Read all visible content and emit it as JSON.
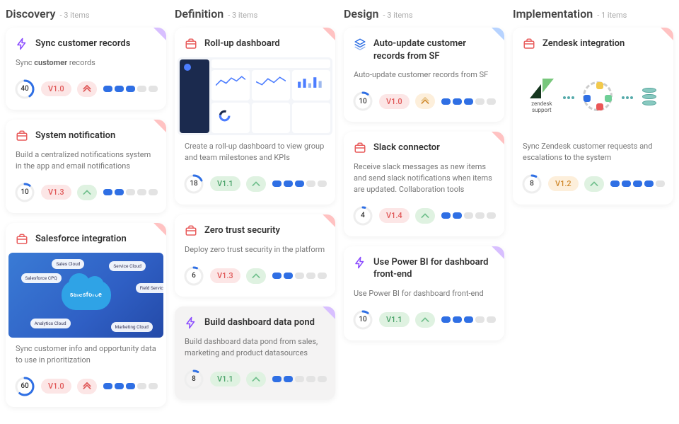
{
  "columns": [
    {
      "id": "discovery",
      "title": "Discovery",
      "count_label": "- 3 items"
    },
    {
      "id": "definition",
      "title": "Definition",
      "count_label": "- 3 items"
    },
    {
      "id": "design",
      "title": "Design",
      "count_label": "- 3 items"
    },
    {
      "id": "implementation",
      "title": "Implementation",
      "count_label": "- 1 items"
    }
  ],
  "cards": {
    "discovery": [
      {
        "id": "sync-records",
        "icon": "bolt",
        "icon_color": "#8a4bff",
        "corner": "#d8bfff",
        "title": "Sync customer records",
        "desc": "Sync customer records",
        "desc_bold_word": "customer",
        "score": 40,
        "version": "V1.0",
        "version_tone": "red",
        "priority": "high-red",
        "dots_on": 3
      },
      {
        "id": "system-notification",
        "icon": "briefcase",
        "icon_color": "#e85c5c",
        "corner": "#ffc2c2",
        "title": "System notification",
        "desc": "Build a centralized notifications system in the app and email notifications",
        "score": 10,
        "version": "V1.3",
        "version_tone": "red",
        "priority": "up-green",
        "dots_on": 2
      },
      {
        "id": "salesforce-integration",
        "icon": "briefcase",
        "icon_color": "#e85c5c",
        "corner": "#ffc2c2",
        "title": "Salesforce integration",
        "thumb": "salesforce",
        "thumb_bubbles": [
          "Salesforce CPQ",
          "Sales Cloud",
          "Service Cloud",
          "Field Service Lightning",
          "Analytics Cloud",
          "Marketing Cloud"
        ],
        "thumb_center": "salesforce",
        "desc": "Sync customer info and opportunity data to use in prioritization",
        "score": 60,
        "version": "V1.0",
        "version_tone": "red",
        "priority": "high-red",
        "dots_on": 3
      }
    ],
    "definition": [
      {
        "id": "rollup-dashboard",
        "icon": "briefcase",
        "icon_color": "#e85c5c",
        "corner": "#ffc2c2",
        "title": "Roll-up dashboard",
        "thumb": "dashboard",
        "desc": "Create a roll-up dashboard to view group and team milestones and KPIs",
        "score": 18,
        "version": "V1.1",
        "version_tone": "green",
        "priority": "up-green",
        "dots_on": 3
      },
      {
        "id": "zero-trust",
        "icon": "briefcase",
        "icon_color": "#e85c5c",
        "corner": "#ffc2c2",
        "title": "Zero trust security",
        "desc": "Deploy zero trust security in the platform",
        "score": 6,
        "version": "V1.3",
        "version_tone": "red",
        "priority": "up-green",
        "dots_on": 2
      },
      {
        "id": "data-pond",
        "icon": "bolt",
        "icon_color": "#8a4bff",
        "corner": "#d8bfff",
        "title": "Build dashboard data pond",
        "desc": "Build dashboard data pond from sales, marketing and product datasources",
        "score": 8,
        "version": "V1.1",
        "version_tone": "green",
        "priority": "up-green",
        "dots_on": 2,
        "dim": true
      }
    ],
    "design": [
      {
        "id": "auto-update-sf",
        "icon": "layers",
        "icon_color": "#2f6fe4",
        "corner": "#b7d3ff",
        "title": "Auto-update customer records from SF",
        "desc": "Auto-update customer records from SF",
        "score": 10,
        "version": "V1.0",
        "version_tone": "red",
        "priority": "mid-amber",
        "dots_on": 3
      },
      {
        "id": "slack-connector",
        "icon": "briefcase",
        "icon_color": "#e85c5c",
        "corner": "#ffc2c2",
        "title": "Slack connector",
        "desc": "Receive slack messages as new items and send slack notifications when items are updated. Collaboration tools",
        "score": 4,
        "version": "V1.4",
        "version_tone": "red",
        "priority": "up-green",
        "dots_on": 2
      },
      {
        "id": "power-bi",
        "icon": "bolt",
        "icon_color": "#8a4bff",
        "corner": "#d8bfff",
        "title": "Use Power BI for dashboard front-end",
        "desc": "Use Power BI for dashboard front-end",
        "score": 10,
        "version": "V1.1",
        "version_tone": "green",
        "priority": "up-green",
        "dots_on": 3
      }
    ],
    "implementation": [
      {
        "id": "zendesk",
        "icon": "briefcase",
        "icon_color": "#e85c5c",
        "corner": "#ffc2c2",
        "title": "Zendesk integration",
        "thumb": "zendesk",
        "thumb_label": "zendesk\nsupport",
        "desc": "Sync Zendesk customer requests and escalations to the system",
        "score": 8,
        "version": "V1.2",
        "version_tone": "amber",
        "priority": "up-green",
        "dots_on": 4
      }
    ]
  }
}
